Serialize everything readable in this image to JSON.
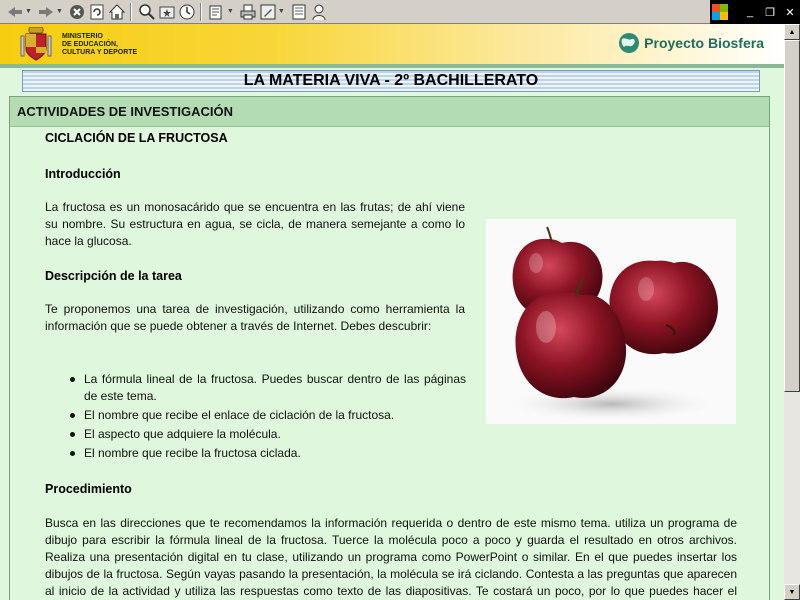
{
  "colors": {
    "page_bg": "#dff7dc",
    "section_header_bg": "#b4dcb2",
    "banner_yellow": "#f6cd10",
    "biosfera_green": "#1f6d5c"
  },
  "toolbar": {
    "icons": [
      "back-icon",
      "forward-icon",
      "stop-icon",
      "refresh-icon",
      "home-icon",
      "search-icon",
      "favorites-icon",
      "history-icon",
      "mail-icon",
      "print-icon",
      "edit-icon",
      "discuss-icon",
      "messenger-icon"
    ]
  },
  "banner": {
    "ministry_line1": "MINISTERIO",
    "ministry_line2": "DE EDUCACIÓN,",
    "ministry_line3": "CULTURA Y DEPORTE",
    "biosfera": "Proyecto Biosfera"
  },
  "page": {
    "title": "LA MATERIA VIVA - 2º BACHILLERATO",
    "section": "ACTIVIDADES DE INVESTIGACIÓN",
    "activity_title": "CICLACIÓN DE LA FRUCTOSA",
    "intro_heading": "Introducción",
    "intro_text": "La fructosa es un monosacárido que se encuentra en las frutas; de ahí viene su nombre. Su estructura en agua, se cicla, de manera semejante a como lo hace la glucosa.",
    "task_heading": "Descripción de la tarea",
    "task_text": "Te proponemos una tarea de investigación, utilizando como herramienta la información que se puede obtener a través de Internet. Debes descubrir:",
    "task_items": [
      "La fórmula lineal de la fructosa. Puedes buscar dentro de las páginas de este tema.",
      "El nombre que recibe el enlace de ciclación de la fructosa.",
      "El aspecto que adquiere la molécula.",
      "El nombre que recibe la fructosa ciclada."
    ],
    "procedure_heading": "Procedimiento",
    "procedure_text": "Busca en las direcciones que te recomendamos la información requerida o dentro de este mismo tema. utiliza un programa de dibujo para escribir la fórmula lineal de la fructosa. Tuerce la molécula poco a poco y guarda el resultado en otros archivos. Realiza una presentación digital en tu clase, utilizando un programa como PowerPoint o similar. En el que puedes insertar los dibujos de la fructosa. Según vayas pasando la presentación, la molécula se irá ciclando. Contesta a las preguntas que aparecen al inicio de la actividad y utiliza las respuestas como texto de las diapositivas. Te costará un poco, por lo que puedes hacer el trabajo con otros compañeros. En cualquier caso, el resultado será"
  }
}
